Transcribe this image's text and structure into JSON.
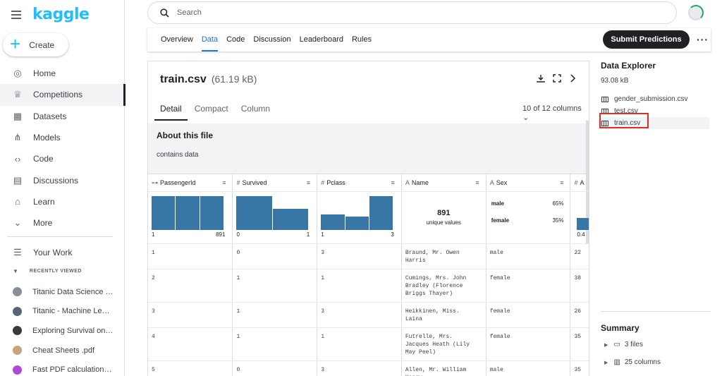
{
  "brand": {
    "logo": "kaggle"
  },
  "sidebar": {
    "create_label": "Create",
    "items": [
      {
        "label": "Home",
        "icon": "compass-icon",
        "glyph": "◎"
      },
      {
        "label": "Competitions",
        "icon": "trophy-icon",
        "glyph": "♕"
      },
      {
        "label": "Datasets",
        "icon": "table-icon",
        "glyph": "▦"
      },
      {
        "label": "Models",
        "icon": "models-icon",
        "glyph": "⋔"
      },
      {
        "label": "Code",
        "icon": "code-icon",
        "glyph": "‹›"
      },
      {
        "label": "Discussions",
        "icon": "comments-icon",
        "glyph": "▤"
      },
      {
        "label": "Learn",
        "icon": "school-icon",
        "glyph": "⌂"
      },
      {
        "label": "More",
        "icon": "chevron-down-icon",
        "glyph": "⌄"
      }
    ],
    "your_work": {
      "label": "Your Work",
      "glyph": "☰"
    },
    "recently_viewed_label": "RECENTLY VIEWED",
    "recent": [
      {
        "label": "Titanic Data Science S...",
        "color": "#8a8f96"
      },
      {
        "label": "Titanic - Machine Lear...",
        "color": "#5b6770"
      },
      {
        "label": "Exploring Survival on t...",
        "color": "#3a3a3a"
      },
      {
        "label": "Cheat Sheets .pdf",
        "color": "#c9a27e"
      },
      {
        "label": "Fast PDF calculation w...",
        "color": "#b04ad8"
      }
    ]
  },
  "search": {
    "placeholder": "Search"
  },
  "tabs": [
    "Overview",
    "Data",
    "Code",
    "Discussion",
    "Leaderboard",
    "Rules"
  ],
  "active_tab": "Data",
  "submit_label": "Submit Predictions",
  "more_label": "···",
  "file": {
    "name": "train.csv",
    "size": "(61.19 kB)",
    "subtabs": [
      "Detail",
      "Compact",
      "Column"
    ],
    "columns_selector": "10 of 12 columns ⌄",
    "about_title": "About this file",
    "about_text": "contains data"
  },
  "table": {
    "headers": [
      {
        "icon": "⊶",
        "label": "PassengerId"
      },
      {
        "icon": "#",
        "label": "Survived"
      },
      {
        "icon": "#",
        "label": "Pclass"
      },
      {
        "icon": "A",
        "label": "Name"
      },
      {
        "icon": "A",
        "label": "Sex"
      },
      {
        "icon": "#",
        "label": "A"
      }
    ],
    "viz": {
      "passengerid": {
        "bars": [
          1.0,
          1.0,
          1.0
        ],
        "min": "1",
        "max": "891"
      },
      "survived": {
        "bars": [
          1.0,
          0.62
        ],
        "min": "0",
        "max": "1"
      },
      "pclass": {
        "bars": [
          0.45,
          0.39,
          1.0
        ],
        "min": "1",
        "max": "3"
      },
      "name": {
        "count": "891",
        "label": "unique values"
      },
      "sex": [
        {
          "label": "male",
          "pct": "65%"
        },
        {
          "label": "female",
          "pct": "35%"
        }
      ],
      "age_min": "0.4"
    },
    "rows": [
      [
        "1",
        "0",
        "3",
        "Braund, Mr. Owen Harris",
        "male",
        "22"
      ],
      [
        "2",
        "1",
        "1",
        "Cumings, Mrs. John Bradley (Florence Briggs Thayer)",
        "female",
        "38"
      ],
      [
        "3",
        "1",
        "3",
        "Heikkinen, Miss. Laina",
        "female",
        "26"
      ],
      [
        "4",
        "1",
        "1",
        "Futrelle, Mrs. Jacques Heath (Lily May Peel)",
        "female",
        "35"
      ],
      [
        "5",
        "0",
        "3",
        "Allen, Mr. William Henry",
        "male",
        "35"
      ]
    ]
  },
  "explorer": {
    "title": "Data Explorer",
    "size": "93.08 kB",
    "files": [
      "gender_submission.csv",
      "test.csv",
      "train.csv"
    ],
    "active_file": "train.csv"
  },
  "summary": {
    "title": "Summary",
    "items": [
      {
        "label": "3 files",
        "icon": "folder-icon"
      },
      {
        "label": "25 columns",
        "icon": "columns-icon"
      }
    ]
  }
}
